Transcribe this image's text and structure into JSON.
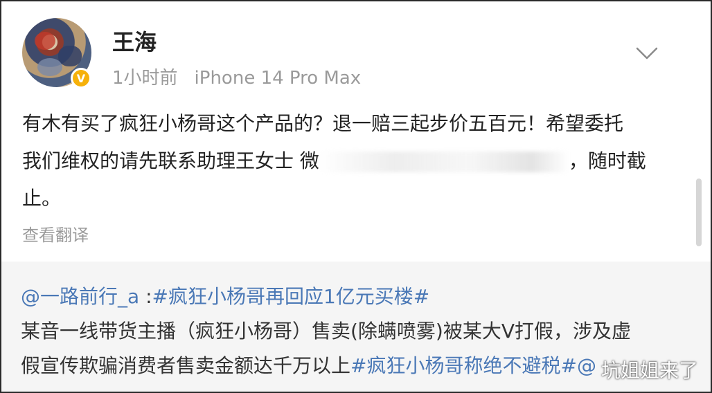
{
  "post": {
    "username": "王海",
    "time": "1小时前",
    "device": "iPhone 14 Pro Max",
    "content_line1": "有木有买了疯狂小杨哥这个产品的？退一赔三起步价五百元！希望委托",
    "content_line2_start": "我们维权的请先联系助理王女士 微",
    "content_line2_end": "，随时截",
    "content_line3": "止。",
    "translate_label": "查看翻译"
  },
  "repost": {
    "author": "@一路前行_a",
    "colon": " :",
    "hashtag1": "#疯狂小杨哥再回应1亿元买楼#",
    "text1": "某音一线带货主播（疯狂小杨哥）售卖(除螨喷雾)被某大V打假，涉及虚",
    "text2": "假宣传欺骗消费者售卖金额达千万以上",
    "hashtag2": "#疯狂小杨哥称绝不避税#",
    "mention_partial": "@"
  },
  "watermark": "坑姐姐来了",
  "colors": {
    "link": "#4a78b6",
    "meta_gray": "#9a9a9a",
    "verified_badge": "#f6b10a",
    "repost_bg": "#f5f5f5"
  },
  "icons": {
    "expand": "chevron-down-icon",
    "verified": "verified-badge-icon"
  }
}
